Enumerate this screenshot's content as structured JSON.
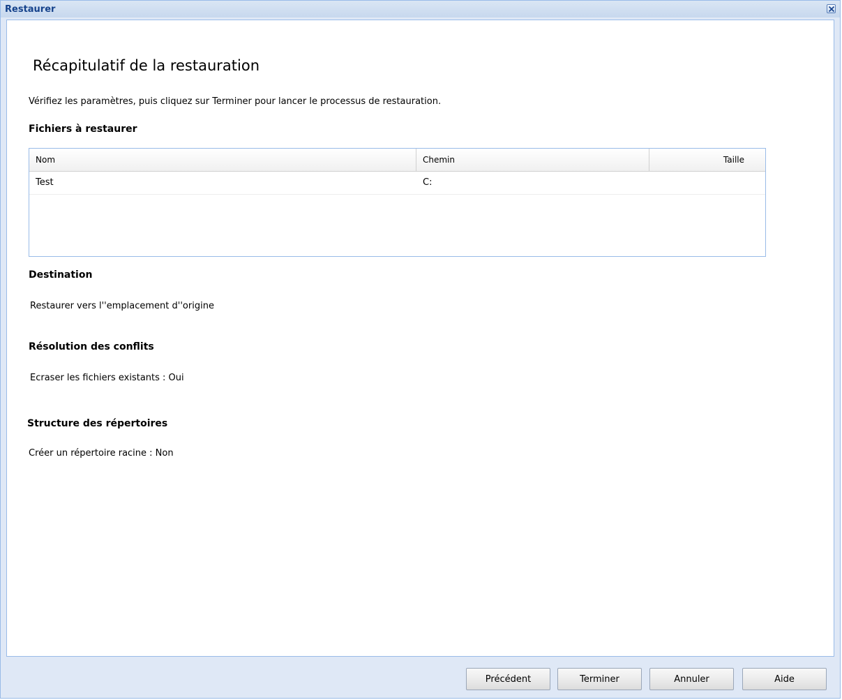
{
  "window": {
    "title": "Restaurer"
  },
  "page": {
    "heading": "Récapitulatif de la restauration",
    "instructions": "Vérifiez les paramètres, puis cliquez sur Terminer pour lancer le processus de restauration."
  },
  "files": {
    "label": "Fichiers à restaurer",
    "columns": [
      "Nom",
      "Chemin",
      "Taille"
    ],
    "rows": [
      {
        "name": "Test",
        "path": "C:",
        "size": ""
      }
    ]
  },
  "destination": {
    "label": "Destination",
    "value": "Restaurer vers l''emplacement d''origine"
  },
  "conflicts": {
    "label": "Résolution des conflits",
    "value": "Ecraser les fichiers existants : Oui"
  },
  "structure": {
    "label": "Structure des répertoires",
    "value": "Créer un répertoire racine : Non"
  },
  "buttons": {
    "previous": "Précédent",
    "finish": "Terminer",
    "cancel": "Annuler",
    "help": "Aide"
  },
  "icons": {
    "close": "close-icon"
  }
}
